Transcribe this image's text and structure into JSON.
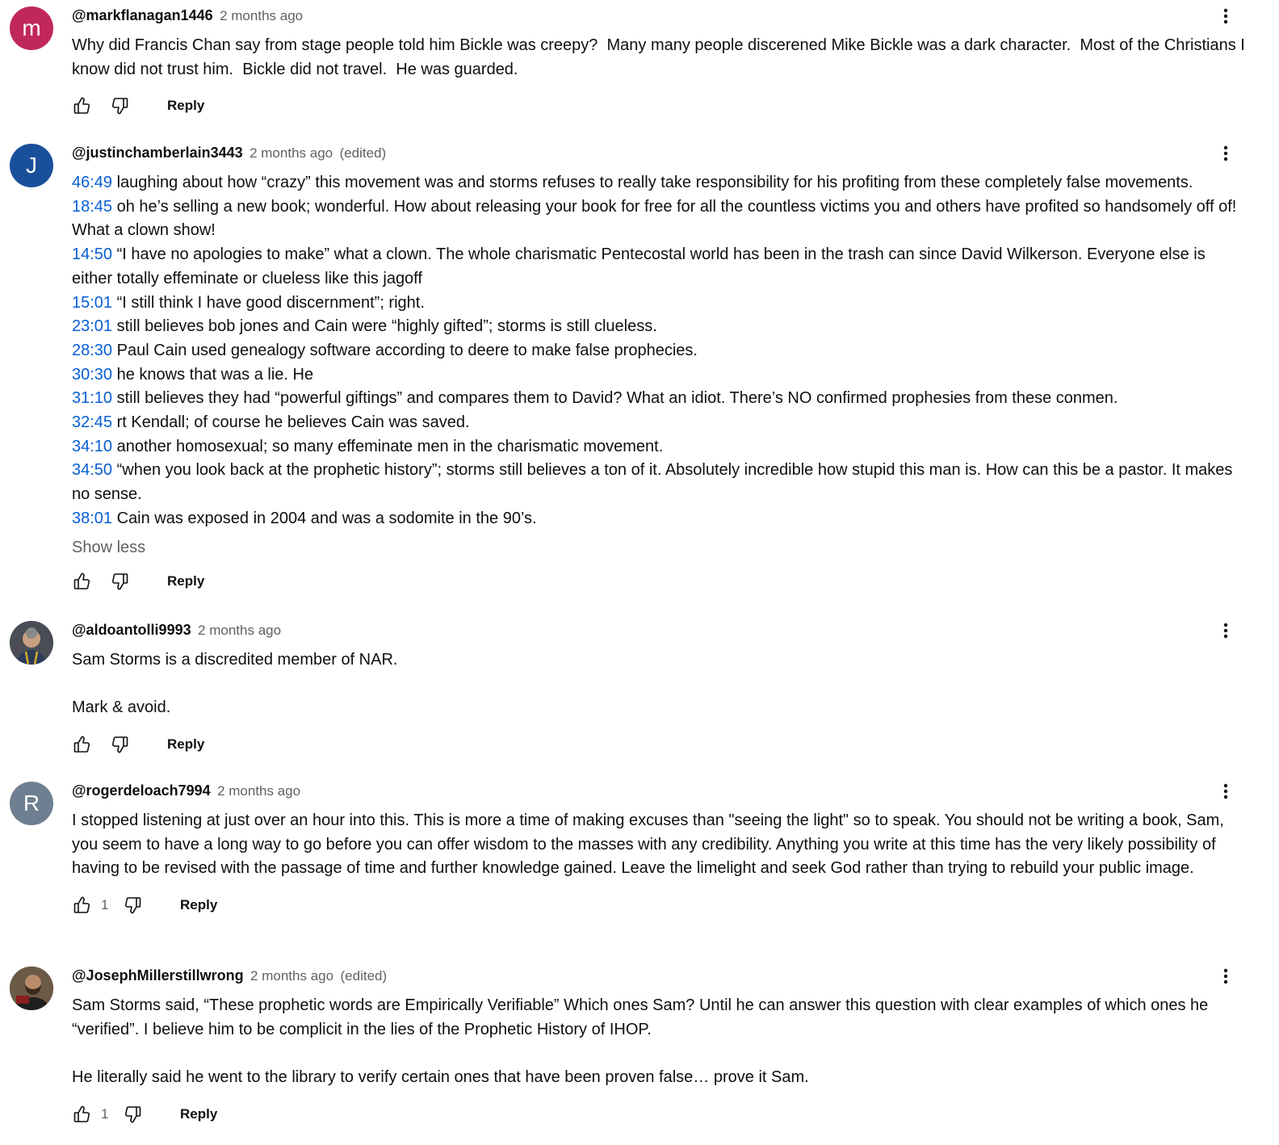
{
  "comments": [
    {
      "author": "@markflanagan1446",
      "time": "2 months ago",
      "edited": "",
      "avatar_letter": "m",
      "avatar_color": "#c0285a",
      "text_lines": [
        "Why did Francis Chan say from stage people told him Bickle was creepy?  Many many people discerened Mike Bickle was a dark character.  Most of the Christians I know did not trust him.  Bickle did not travel.  He was guarded."
      ],
      "likes": "",
      "reply_label": "Reply"
    },
    {
      "author": "@justinchamberlain3443",
      "time": "2 months ago",
      "edited": "(edited)",
      "avatar_letter": "J",
      "avatar_color": "#1a4f9c",
      "timestamped_lines": [
        {
          "ts": "46:49",
          "text": " laughing about how “crazy” this movement was and storms refuses to really take responsibility for his profiting from these completely false movements."
        },
        {
          "ts": "18:45",
          "text": " oh he’s selling a new book; wonderful. How about releasing your book for free for all the countless victims you and others have profited so handsomely off of! What a clown show!"
        },
        {
          "ts": "14:50",
          "text": " “I have no apologies to make” what a clown. The whole charismatic Pentecostal world has been in the trash can since David Wilkerson. Everyone else is either totally effeminate or clueless like this jagoff"
        },
        {
          "ts": "15:01",
          "text": " “I still think I have good discernment”; right."
        },
        {
          "ts": "23:01",
          "text": " still believes bob jones and Cain were “highly gifted”; storms is still clueless."
        },
        {
          "ts": "28:30",
          "text": " Paul Cain used genealogy software according to deere to make false prophecies."
        },
        {
          "ts": "30:30",
          "text": " he knows that was a lie. He"
        },
        {
          "ts": "31:10",
          "text": " still believes they had “powerful giftings” and compares them to David? What an idiot. There’s NO confirmed prophesies from these conmen."
        },
        {
          "ts": "32:45",
          "text": " rt Kendall; of course he believes Cain was saved."
        },
        {
          "ts": "34:10",
          "text": " another homosexual; so many effeminate men in the charismatic movement."
        },
        {
          "ts": "34:50",
          "text": " “when you look back at the prophetic history”; storms still believes a ton of it. Absolutely incredible how stupid this man is. How can this be a pastor. It makes no sense."
        },
        {
          "ts": "38:01",
          "text": " Cain was exposed in 2004 and was a sodomite in the 90’s."
        }
      ],
      "show_less_label": "Show less",
      "likes": "",
      "reply_label": "Reply"
    },
    {
      "author": "@aldoantolli9993",
      "time": "2 months ago",
      "edited": "",
      "text_lines": [
        "Sam Storms is a discredited member of NAR.\n\nMark & avoid."
      ],
      "likes": "",
      "reply_label": "Reply"
    },
    {
      "author": "@rogerdeloach7994",
      "time": "2 months ago",
      "edited": "",
      "avatar_letter": "R",
      "avatar_color": "#6d7f90",
      "text_lines": [
        "I stopped listening at just over an hour into this. This is more a time of making excuses than \"seeing the light\" so to speak. You should not be writing a book, Sam, you seem to have a long way to go before you can offer wisdom to the masses with any credibility. Anything you write at this time has the very likely possibility of having to be revised with the passage of time and further knowledge gained. Leave the limelight and seek God rather than trying to rebuild your public image."
      ],
      "likes": "1",
      "reply_label": "Reply"
    },
    {
      "author": "@JosephMillerstillwrong",
      "time": "2 months ago",
      "edited": "(edited)",
      "text_lines": [
        "Sam Storms said, “These prophetic words are Empirically Verifiable” Which ones Sam? Until he can answer this question with clear examples of which ones he “verified”. I believe him to be complicit in the lies of the Prophetic History of IHOP.\n\nHe literally said he went to the library to verify certain ones that have been proven false… prove it Sam."
      ],
      "likes": "1",
      "reply_label": "Reply"
    }
  ],
  "icons": {
    "like": "thumb-up-outline-icon",
    "dislike": "thumb-down-outline-icon",
    "more": "three-dot-vertical-icon"
  },
  "colors": {
    "link": "#065fd4",
    "secondary_text": "#606060",
    "primary_text": "#0f0f0f"
  }
}
